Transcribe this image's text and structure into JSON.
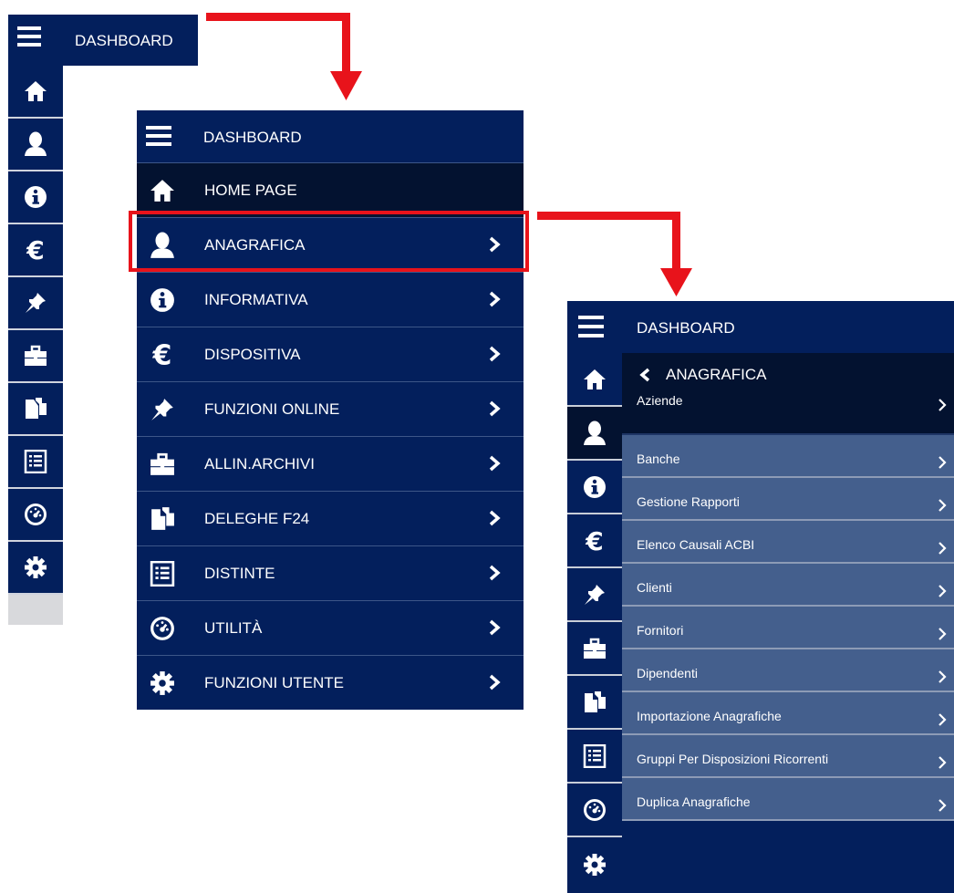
{
  "colors": {
    "navy": "#031f5c",
    "dark_selected": "#031230",
    "submenu_item": "#445f8d",
    "highlight_red": "#e8131b",
    "text": "#ffffff"
  },
  "collapsed_panel": {
    "title": "DASHBOARD",
    "menu_icon": "hamburger-icon",
    "icons": [
      "home-icon",
      "user-icon",
      "info-icon",
      "euro-icon",
      "pin-icon",
      "briefcase-icon",
      "documents-icon",
      "list-icon",
      "gauge-icon",
      "gear-icon"
    ]
  },
  "expanded_panel": {
    "title": "DASHBOARD",
    "menu_icon": "hamburger-icon",
    "items": [
      {
        "label": "HOME PAGE",
        "icon": "home-icon",
        "chevron": false,
        "selected": true
      },
      {
        "label": "ANAGRAFICA",
        "icon": "user-icon",
        "chevron": true,
        "highlighted": true
      },
      {
        "label": "INFORMATIVA",
        "icon": "info-icon",
        "chevron": true
      },
      {
        "label": "DISPOSITIVA",
        "icon": "euro-icon",
        "chevron": true
      },
      {
        "label": "FUNZIONI ONLINE",
        "icon": "pin-icon",
        "chevron": true
      },
      {
        "label": "ALLIN.ARCHIVI",
        "icon": "briefcase-icon",
        "chevron": true
      },
      {
        "label": "DELEGHE F24",
        "icon": "documents-icon",
        "chevron": true
      },
      {
        "label": "DISTINTE",
        "icon": "list-icon",
        "chevron": true
      },
      {
        "label": "UTILITÀ",
        "icon": "gauge-icon",
        "chevron": true
      },
      {
        "label": "FUNZIONI UTENTE",
        "icon": "gear-icon",
        "chevron": true
      }
    ]
  },
  "submenu_panel": {
    "title": "DASHBOARD",
    "back_label": "ANAGRAFICA",
    "icons": [
      "home-icon",
      "user-icon",
      "info-icon",
      "euro-icon",
      "pin-icon",
      "briefcase-icon",
      "documents-icon",
      "list-icon",
      "gauge-icon",
      "gear-icon"
    ],
    "items": [
      {
        "label": "Aziende",
        "selected": true
      },
      {
        "label": "Banche"
      },
      {
        "label": "Gestione Rapporti"
      },
      {
        "label": "Elenco Causali ACBI"
      },
      {
        "label": "Clienti"
      },
      {
        "label": "Fornitori"
      },
      {
        "label": "Dipendenti"
      },
      {
        "label": "Importazione Anagrafiche"
      },
      {
        "label": "Gruppi Per Disposizioni Ricorrenti"
      },
      {
        "label": "Duplica Anagrafiche"
      }
    ]
  }
}
